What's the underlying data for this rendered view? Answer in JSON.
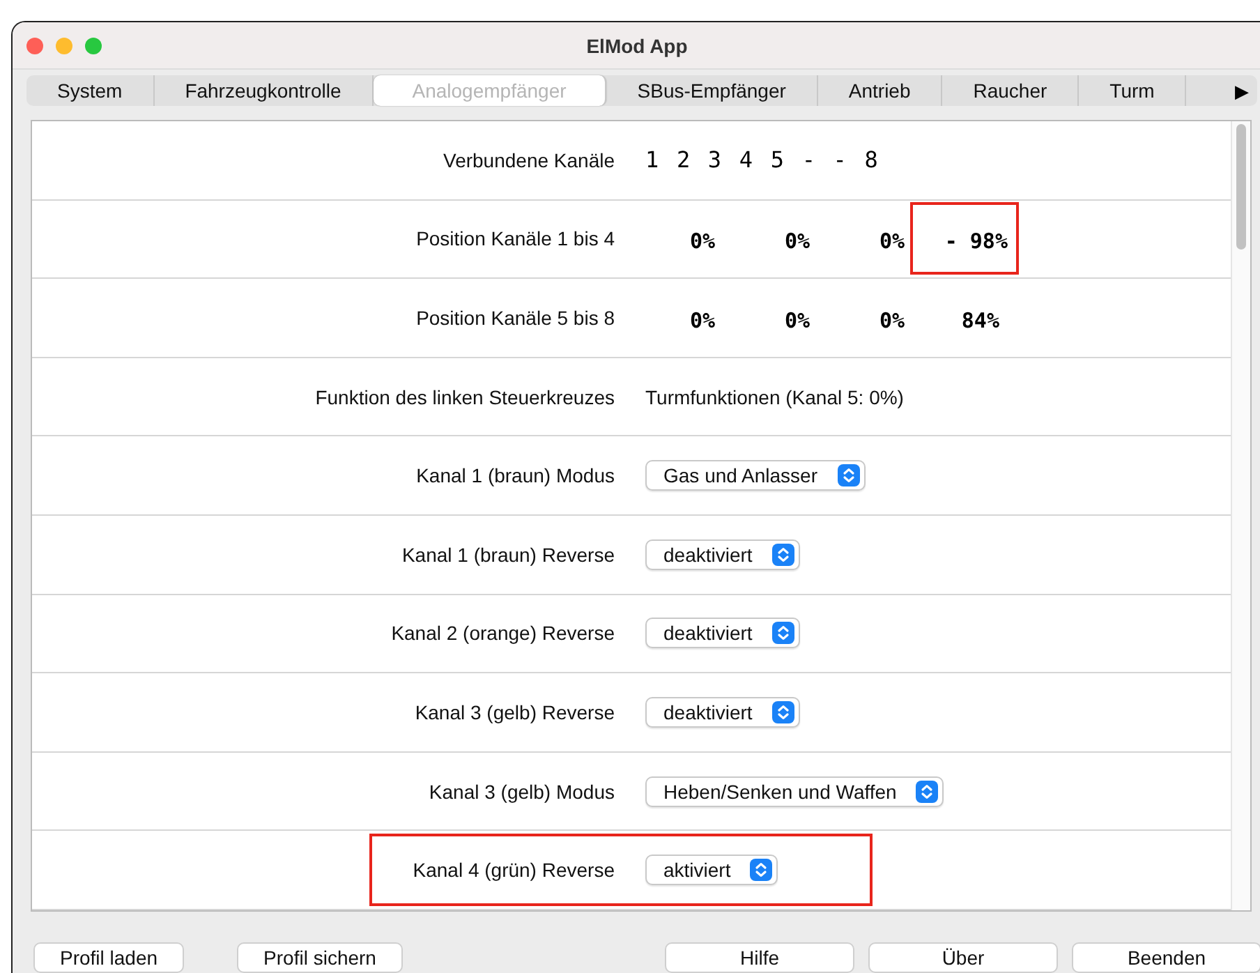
{
  "window": {
    "title": "ElMod App"
  },
  "tabs": [
    {
      "label": "System",
      "selected": false
    },
    {
      "label": "Fahrzeugkontrolle",
      "selected": false
    },
    {
      "label": "Analogempfänger",
      "selected": true
    },
    {
      "label": "SBus-Empfänger",
      "selected": false
    },
    {
      "label": "Antrieb",
      "selected": false
    },
    {
      "label": "Raucher",
      "selected": false
    },
    {
      "label": "Turm",
      "selected": false
    }
  ],
  "tab_scroll": "▶",
  "rows": [
    {
      "kind": "mono",
      "label": "Verbundene Kanäle",
      "value": "1 2 3 4 5 - - 8",
      "highlighted": false
    },
    {
      "kind": "positions",
      "label": "Position Kanäle 1 bis 4",
      "values": [
        {
          "text": "0%",
          "highlighted": false
        },
        {
          "text": "0%",
          "highlighted": false
        },
        {
          "text": "0%",
          "highlighted": false
        },
        {
          "text": "- 98%",
          "highlighted": true
        }
      ],
      "highlighted": false
    },
    {
      "kind": "positions",
      "label": "Position Kanäle 5 bis 8",
      "values": [
        {
          "text": "0%",
          "highlighted": false
        },
        {
          "text": "0%",
          "highlighted": false
        },
        {
          "text": "0%",
          "highlighted": false
        },
        {
          "text": "84%",
          "highlighted": false
        }
      ],
      "highlighted": false
    },
    {
      "kind": "text",
      "label": "Funktion des linken Steuerkreuzes",
      "value": "Turmfunktionen (Kanal 5: 0%)",
      "highlighted": false
    },
    {
      "kind": "select",
      "label": "Kanal 1 (braun) Modus",
      "value": "Gas und Anlasser",
      "highlighted": false
    },
    {
      "kind": "select",
      "label": "Kanal 1 (braun) Reverse",
      "value": "deaktiviert",
      "highlighted": false
    },
    {
      "kind": "select",
      "label": "Kanal 2 (orange) Reverse",
      "value": "deaktiviert",
      "highlighted": false
    },
    {
      "kind": "select",
      "label": "Kanal 3 (gelb) Reverse",
      "value": "deaktiviert",
      "highlighted": false
    },
    {
      "kind": "select",
      "label": "Kanal 3 (gelb) Modus",
      "value": "Heben/Senken und Waffen",
      "highlighted": false
    },
    {
      "kind": "select",
      "label": "Kanal 4 (grün) Reverse",
      "value": "aktiviert",
      "highlighted": true
    }
  ],
  "buttons_left": [
    "Profil laden",
    "Profil sichern"
  ],
  "buttons_right": [
    "Hilfe",
    "Über",
    "Beenden"
  ]
}
